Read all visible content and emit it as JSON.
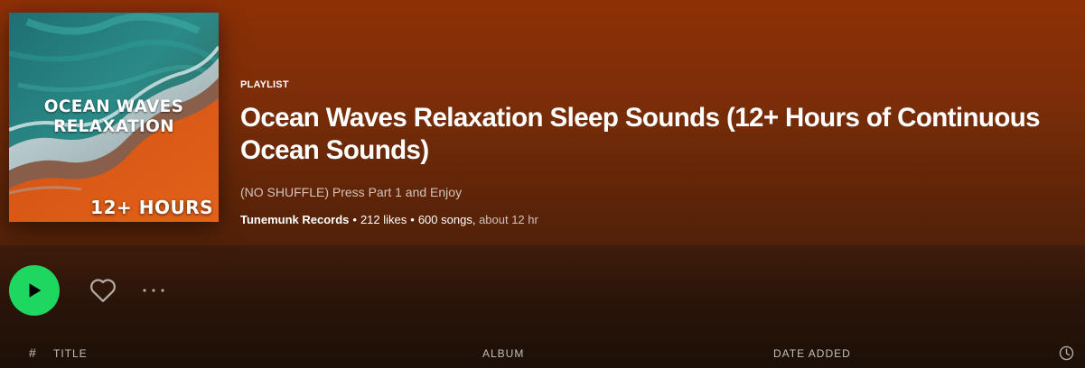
{
  "colors": {
    "header_top": "#8e3006",
    "play_green": "#1ed760",
    "background": "#1e1109"
  },
  "cover": {
    "title_line1": "OCEAN WAVES",
    "title_line2": "RELAXATION",
    "badge": "12+ HOURS"
  },
  "playlist": {
    "type_label": "PLAYLIST",
    "title": "Ocean Waves Relaxation Sleep Sounds (12+ Hours of Continuous Ocean Sounds)",
    "description": "(NO SHUFFLE) Press Part 1 and Enjoy",
    "owner": "Tunemunk Records",
    "separator": "•",
    "likes": "212 likes",
    "songs": "600 songs,",
    "duration": "about 12 hr"
  },
  "actions": {
    "play_icon": "play-icon",
    "heart_icon": "heart-icon",
    "more_icon": "more-dots-icon"
  },
  "table": {
    "num_header": "#",
    "title_header": "TITLE",
    "album_header": "ALBUM",
    "date_header": "DATE ADDED",
    "duration_icon": "clock-icon"
  }
}
